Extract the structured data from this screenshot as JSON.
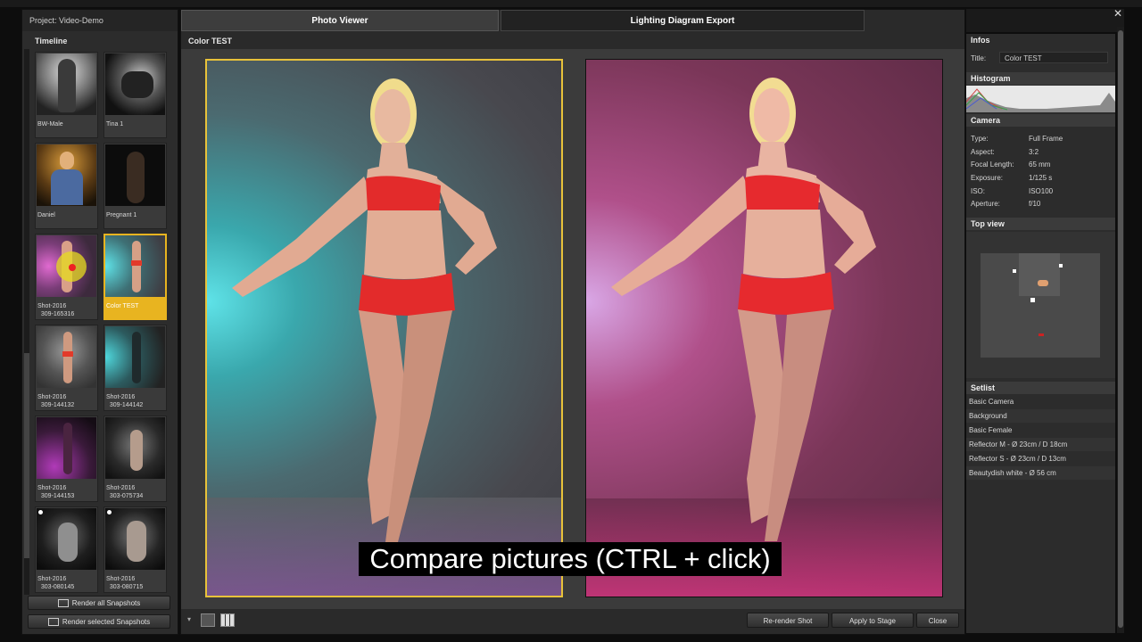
{
  "project": {
    "title": "Project: Video-Demo"
  },
  "timeline": {
    "heading": "Timeline",
    "items": [
      {
        "label": "BW-Male",
        "selected": false
      },
      {
        "label": "Tina 1",
        "selected": false
      },
      {
        "label": "Daniel",
        "selected": false
      },
      {
        "label": "Pregnant 1",
        "selected": false
      },
      {
        "label": "Shot-2016\n  309-165316",
        "selected": false
      },
      {
        "label": "Color TEST",
        "selected": true
      },
      {
        "label": "Shot-2016\n  309-144132",
        "selected": false
      },
      {
        "label": "Shot-2016\n  309-144142",
        "selected": false
      },
      {
        "label": "Shot-2016\n  309-144153",
        "selected": false
      },
      {
        "label": "Shot-2016\n  303-075734",
        "selected": false
      },
      {
        "label": "Shot-2016\n  303-080145",
        "selected": false
      },
      {
        "label": "Shot-2016\n  303-080715",
        "selected": false
      }
    ],
    "render_all": "Render all Snapshots",
    "render_selected": "Render selected Snapshots"
  },
  "tabs": [
    {
      "label": "Photo Viewer",
      "active": true
    },
    {
      "label": "Lighting Diagram Export",
      "active": false
    }
  ],
  "viewer": {
    "title": "Color TEST",
    "caption": "Compare pictures (CTRL + click)",
    "buttons": {
      "rerender": "Re-render Shot",
      "apply": "Apply to Stage",
      "close": "Close"
    }
  },
  "infos": {
    "heading": "Infos",
    "title_label": "Title:",
    "title_value": "Color TEST",
    "histogram_heading": "Histogram",
    "camera_heading": "Camera",
    "camera": [
      {
        "k": "Type:",
        "v": "Full Frame"
      },
      {
        "k": "Aspect:",
        "v": "3:2"
      },
      {
        "k": "Focal Length:",
        "v": "65 mm"
      },
      {
        "k": "Exposure:",
        "v": "1/125 s"
      },
      {
        "k": "ISO:",
        "v": "ISO100"
      },
      {
        "k": "Aperture:",
        "v": "f/10"
      }
    ],
    "topview_heading": "Top view",
    "setlist_heading": "Setlist",
    "setlist": [
      "Basic Camera",
      "Background",
      "Basic Female",
      "Reflector M - Ø 23cm / D 18cm",
      "Reflector S - Ø 23cm / D 13cm",
      "Beautydish white - Ø 56 cm"
    ]
  },
  "colors": {
    "accent": "#e8b420",
    "frame": "#e8c23a"
  },
  "icons": [
    "close-icon",
    "render-icon",
    "single-view-icon",
    "grid-view-icon",
    "pin-icon"
  ]
}
